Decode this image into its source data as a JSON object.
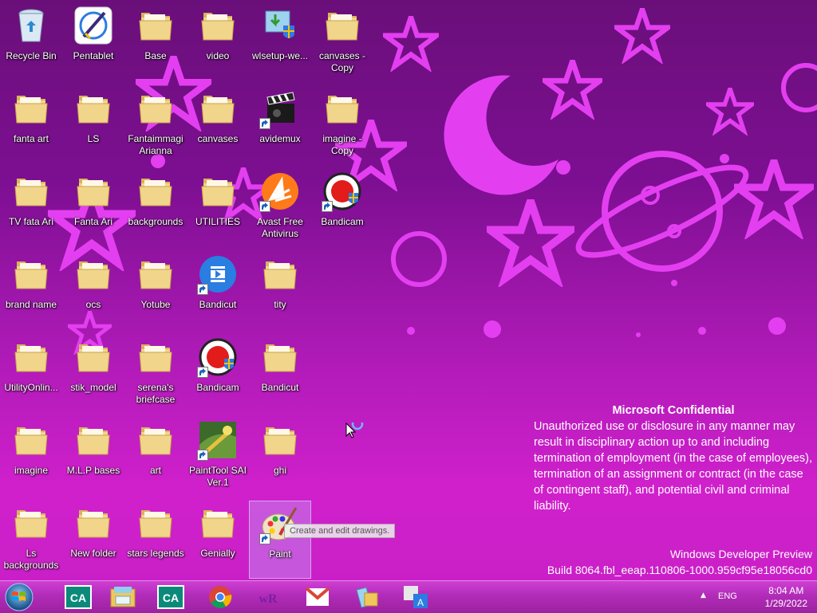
{
  "colors": {
    "wallpaper_top": "#6a0f7a",
    "wallpaper_bottom": "#c81fc6",
    "decor": "#e33ff0",
    "folder": "#f1d58a",
    "taskbar": "#b12cb8"
  },
  "desktop": {
    "icons": [
      {
        "label": "Recycle Bin",
        "icon": "recycle-bin-icon",
        "type": "bin",
        "shortcut": false
      },
      {
        "label": "Pentablet",
        "icon": "pentablet-icon",
        "type": "pentablet",
        "shortcut": false
      },
      {
        "label": "Base",
        "icon": "folder-icon",
        "type": "folder",
        "shortcut": false
      },
      {
        "label": "video",
        "icon": "folder-icon",
        "type": "folder",
        "shortcut": false
      },
      {
        "label": "wlsetup-we...",
        "icon": "installer-icon",
        "type": "installer",
        "shortcut": false
      },
      {
        "label": "canvases - Copy",
        "icon": "folder-icon",
        "type": "folder",
        "shortcut": false
      },
      {
        "label": "fanta art",
        "icon": "folder-icon",
        "type": "folder",
        "shortcut": false
      },
      {
        "label": "LS",
        "icon": "folder-icon",
        "type": "folder",
        "shortcut": false
      },
      {
        "label": "Fantaimmagi Arianna",
        "icon": "folder-icon",
        "type": "folder",
        "shortcut": false
      },
      {
        "label": "canvases",
        "icon": "folder-icon",
        "type": "folder",
        "shortcut": false
      },
      {
        "label": "avidemux",
        "icon": "clapperboard-icon",
        "type": "clapper",
        "shortcut": true
      },
      {
        "label": "imagine - Copy",
        "icon": "folder-icon",
        "type": "folder",
        "shortcut": false
      },
      {
        "label": "TV fata Ari",
        "icon": "folder-icon",
        "type": "folder",
        "shortcut": false
      },
      {
        "label": "Fanta Ari",
        "icon": "folder-icon",
        "type": "folder",
        "shortcut": false
      },
      {
        "label": "backgrounds",
        "icon": "folder-icon",
        "type": "folder",
        "shortcut": false
      },
      {
        "label": "UTILITIES",
        "icon": "folder-icon",
        "type": "folder",
        "shortcut": false
      },
      {
        "label": "Avast Free Antivirus",
        "icon": "avast-icon",
        "type": "avast",
        "shortcut": true
      },
      {
        "label": "Bandicam",
        "icon": "bandicam-icon",
        "type": "bandicam",
        "shortcut": true
      },
      {
        "label": "brand name",
        "icon": "folder-icon",
        "type": "folder",
        "shortcut": false
      },
      {
        "label": "ocs",
        "icon": "folder-icon",
        "type": "folder",
        "shortcut": false
      },
      {
        "label": "Yotube",
        "icon": "folder-icon",
        "type": "folder",
        "shortcut": false
      },
      {
        "label": "Bandicut",
        "icon": "bandicut-icon",
        "type": "bandicut",
        "shortcut": true
      },
      {
        "label": "tity",
        "icon": "folder-icon",
        "type": "folder",
        "shortcut": false
      },
      {
        "label": "UtilityOnlin...",
        "icon": "folder-icon",
        "type": "folder",
        "shortcut": false
      },
      {
        "label": "stik_model",
        "icon": "folder-icon",
        "type": "folder",
        "shortcut": false
      },
      {
        "label": "serena's briefcase",
        "icon": "folder-icon",
        "type": "folder",
        "shortcut": false
      },
      {
        "label": "Bandicam",
        "icon": "bandicam-icon",
        "type": "bandicam",
        "shortcut": true
      },
      {
        "label": "Bandicut",
        "icon": "folder-icon",
        "type": "folder",
        "shortcut": false
      },
      {
        "label": "imagine",
        "icon": "folder-icon",
        "type": "folder",
        "shortcut": false
      },
      {
        "label": "M.L.P bases",
        "icon": "folder-icon",
        "type": "folder",
        "shortcut": false
      },
      {
        "label": "art",
        "icon": "folder-icon",
        "type": "folder",
        "shortcut": false
      },
      {
        "label": "PaintTool SAI Ver.1",
        "icon": "painttool-sai-icon",
        "type": "sai",
        "shortcut": true
      },
      {
        "label": "ghi",
        "icon": "folder-icon",
        "type": "folder",
        "shortcut": false
      },
      {
        "label": "Ls backgrounds",
        "icon": "folder-icon",
        "type": "folder",
        "shortcut": false
      },
      {
        "label": "New folder",
        "icon": "folder-icon",
        "type": "folder",
        "shortcut": false
      },
      {
        "label": "stars legends",
        "icon": "folder-icon",
        "type": "folder",
        "shortcut": false
      },
      {
        "label": "Genially",
        "icon": "folder-icon",
        "type": "folder",
        "shortcut": false
      },
      {
        "label": "Paint",
        "icon": "paint-palette-icon",
        "type": "paint",
        "shortcut": true,
        "selected": true
      }
    ],
    "tooltip": "Create and edit drawings."
  },
  "watermark": {
    "title": "Microsoft Confidential",
    "body": "Unauthorized use or disclosure in any manner may result in disciplinary action up to and including termination of employment (in the case of employees), termination of an assignment or contract (in the case of contingent staff), and potential civil and criminal liability."
  },
  "build": {
    "line1": "Windows Developer Preview",
    "line2": "Build 8064.fbl_eeap.110806-1000.959cf95e18056cd0"
  },
  "taskbar": {
    "start_icon": "windows-logo-icon",
    "pinned": [
      {
        "name": "credit-agricole-icon",
        "glyph": "CA"
      },
      {
        "name": "file-explorer-icon",
        "glyph": ""
      },
      {
        "name": "credit-agricole-icon",
        "glyph": "CA"
      },
      {
        "name": "chrome-icon",
        "glyph": ""
      },
      {
        "name": "winrar-icon",
        "glyph": "wR"
      },
      {
        "name": "gmail-icon",
        "glyph": ""
      },
      {
        "name": "folders-icon",
        "glyph": ""
      },
      {
        "name": "translate-icon",
        "glyph": "A"
      }
    ],
    "tray": {
      "language": "ENG",
      "time": "8:04 AM",
      "date": "1/29/2022"
    }
  }
}
